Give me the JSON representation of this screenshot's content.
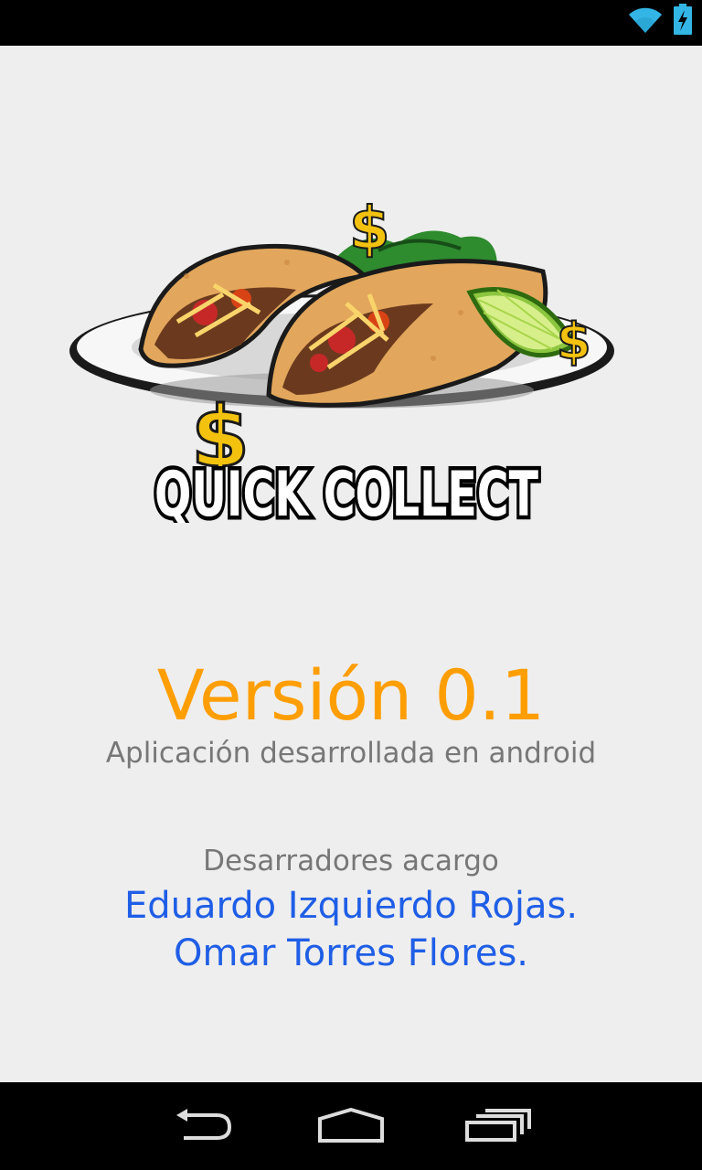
{
  "status_bar": {
    "icons": [
      "wifi-icon",
      "battery-charging-icon"
    ],
    "accent_color": "#33b5e5"
  },
  "logo": {
    "text": "QUICK COLLECT",
    "dollar_glyph": "$"
  },
  "about": {
    "version": "Versión 0.1",
    "subtitle": "Aplicación desarrollada en android",
    "developers_title": "Desarradores acargo",
    "developers": [
      "Eduardo Izquierdo Rojas.",
      "Omar Torres Flores."
    ]
  },
  "colors": {
    "version": "#ff9e00",
    "developer_names": "#1f5ee6",
    "muted_text": "#777777",
    "background": "#eeeeee"
  },
  "nav_bar": {
    "icons": [
      "back-icon",
      "home-icon",
      "recent-apps-icon"
    ]
  }
}
